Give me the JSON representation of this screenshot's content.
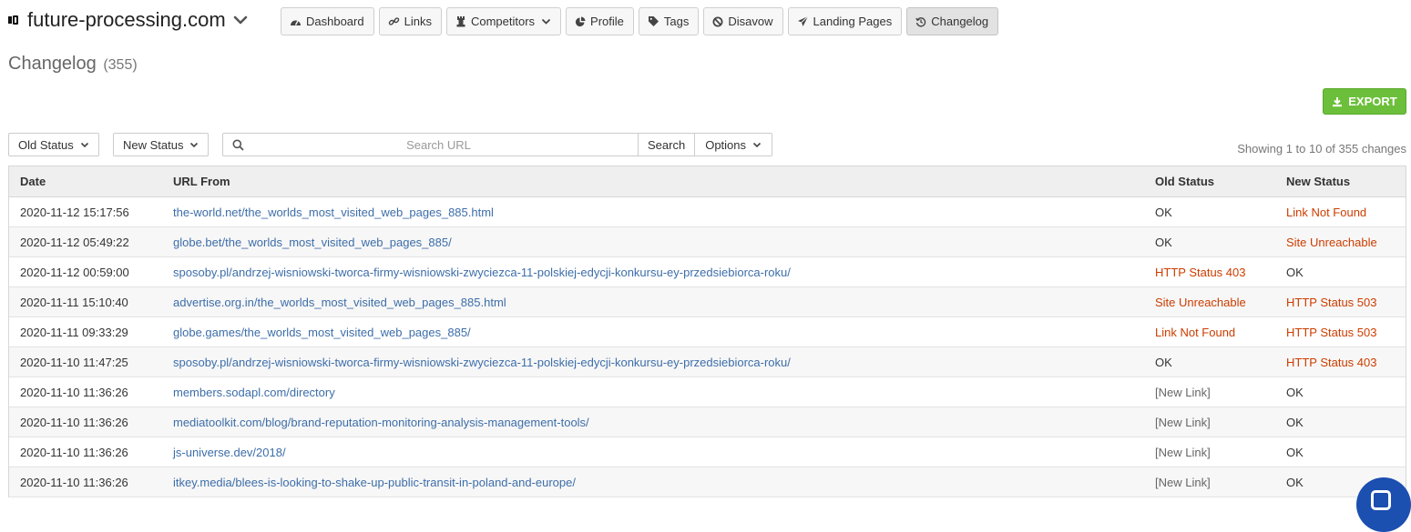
{
  "site": {
    "name": "future-processing.com"
  },
  "nav": [
    {
      "label": "Dashboard",
      "icon": "dashboard-icon",
      "has_caret": false,
      "active": false
    },
    {
      "label": "Links",
      "icon": "link-icon",
      "has_caret": false,
      "active": false
    },
    {
      "label": "Competitors",
      "icon": "chess-icon",
      "has_caret": true,
      "active": false
    },
    {
      "label": "Profile",
      "icon": "pie-chart-icon",
      "has_caret": false,
      "active": false
    },
    {
      "label": "Tags",
      "icon": "tag-icon",
      "has_caret": false,
      "active": false
    },
    {
      "label": "Disavow",
      "icon": "ban-icon",
      "has_caret": false,
      "active": false
    },
    {
      "label": "Landing Pages",
      "icon": "paper-plane-icon",
      "has_caret": false,
      "active": false
    },
    {
      "label": "Changelog",
      "icon": "history-icon",
      "has_caret": false,
      "active": true
    }
  ],
  "page": {
    "title": "Changelog",
    "count": "(355)"
  },
  "toolbar": {
    "export_label": "EXPORT",
    "old_status_label": "Old Status",
    "new_status_label": "New Status",
    "search_placeholder": "Search URL",
    "search_value": "",
    "search_button": "Search",
    "options_label": "Options",
    "showing_text": "Showing 1 to 10 of 355 changes"
  },
  "table": {
    "headers": {
      "date": "Date",
      "url": "URL From",
      "old": "Old Status",
      "new": "New Status"
    },
    "rows": [
      {
        "date": "2020-11-12 15:17:56",
        "url": "the-world.net/the_worlds_most_visited_web_pages_885.html",
        "old": "OK",
        "old_error": false,
        "new": "Link Not Found",
        "new_error": true
      },
      {
        "date": "2020-11-12 05:49:22",
        "url": "globe.bet/the_worlds_most_visited_web_pages_885/",
        "old": "OK",
        "old_error": false,
        "new": "Site Unreachable",
        "new_error": true
      },
      {
        "date": "2020-11-12 00:59:00",
        "url": "sposoby.pl/andrzej-wisniowski-tworca-firmy-wisniowski-zwyciezca-11-polskiej-edycji-konkursu-ey-przedsiebiorca-roku/",
        "old": "HTTP Status 403",
        "old_error": true,
        "new": "OK",
        "new_error": false
      },
      {
        "date": "2020-11-11 15:10:40",
        "url": "advertise.org.in/the_worlds_most_visited_web_pages_885.html",
        "old": "Site Unreachable",
        "old_error": true,
        "new": "HTTP Status 503",
        "new_error": true
      },
      {
        "date": "2020-11-11 09:33:29",
        "url": "globe.games/the_worlds_most_visited_web_pages_885/",
        "old": "Link Not Found",
        "old_error": true,
        "new": "HTTP Status 503",
        "new_error": true
      },
      {
        "date": "2020-11-10 11:47:25",
        "url": "sposoby.pl/andrzej-wisniowski-tworca-firmy-wisniowski-zwyciezca-11-polskiej-edycji-konkursu-ey-przedsiebiorca-roku/",
        "old": "OK",
        "old_error": false,
        "new": "HTTP Status 403",
        "new_error": true
      },
      {
        "date": "2020-11-10 11:36:26",
        "url": "members.sodapl.com/directory",
        "old": "[New Link]",
        "old_error": false,
        "old_muted": true,
        "new": "OK",
        "new_error": false
      },
      {
        "date": "2020-11-10 11:36:26",
        "url": "mediatoolkit.com/blog/brand-reputation-monitoring-analysis-management-tools/",
        "old": "[New Link]",
        "old_error": false,
        "old_muted": true,
        "new": "OK",
        "new_error": false
      },
      {
        "date": "2020-11-10 11:36:26",
        "url": "js-universe.dev/2018/",
        "old": "[New Link]",
        "old_error": false,
        "old_muted": true,
        "new": "OK",
        "new_error": false
      },
      {
        "date": "2020-11-10 11:36:26",
        "url": "itkey.media/blees-is-looking-to-shake-up-public-transit-in-poland-and-europe/",
        "old": "[New Link]",
        "old_error": false,
        "old_muted": true,
        "new": "OK",
        "new_error": false
      }
    ]
  },
  "colors": {
    "error": "#cc3d00",
    "muted": "#666666",
    "link": "#3d6ea9",
    "export_green": "#6cbf3a",
    "chat_blue": "#1b4fb0"
  }
}
